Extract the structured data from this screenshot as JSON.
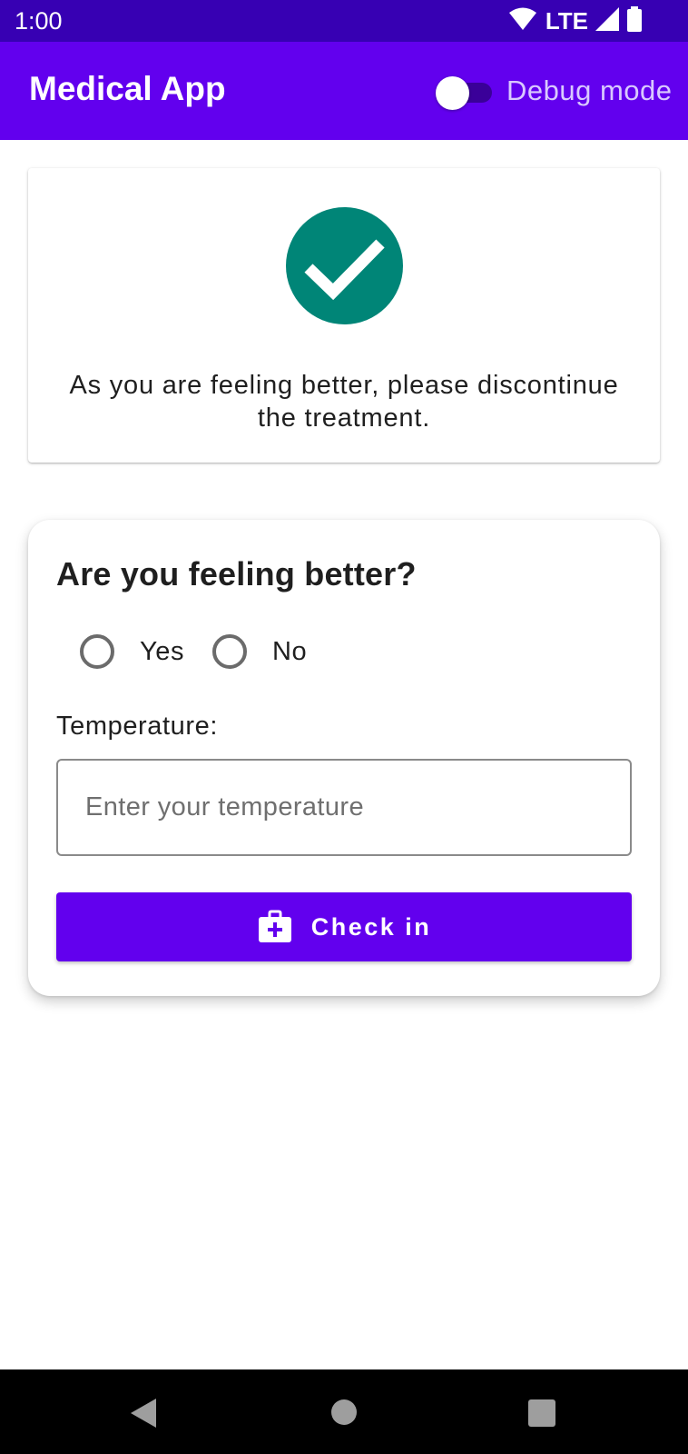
{
  "status_bar": {
    "time": "1:00",
    "network": "LTE",
    "icons": [
      "wifi-icon",
      "cellular-signal-icon",
      "battery-icon"
    ]
  },
  "app_bar": {
    "title": "Medical App",
    "debug_toggle": {
      "label": "Debug mode",
      "on": false
    }
  },
  "result_card": {
    "icon": "check-circle-icon",
    "message": "As you are feeling better, please discontinue the treatment."
  },
  "form": {
    "question": "Are you feeling better?",
    "options": [
      {
        "label": "Yes",
        "selected": false
      },
      {
        "label": "No",
        "selected": false
      }
    ],
    "temperature_label": "Temperature:",
    "temperature_value": "",
    "temperature_placeholder": "Enter your temperature",
    "checkin_icon": "medical-kit-icon",
    "checkin_label": "Check in"
  },
  "nav_bar": {
    "icons": [
      "back-icon",
      "home-icon",
      "recents-icon"
    ]
  },
  "colors": {
    "status_bar": "#3700b3",
    "app_bar": "#6200ee",
    "primary": "#6200ee",
    "success": "#008577",
    "nav_bar": "#000000"
  }
}
